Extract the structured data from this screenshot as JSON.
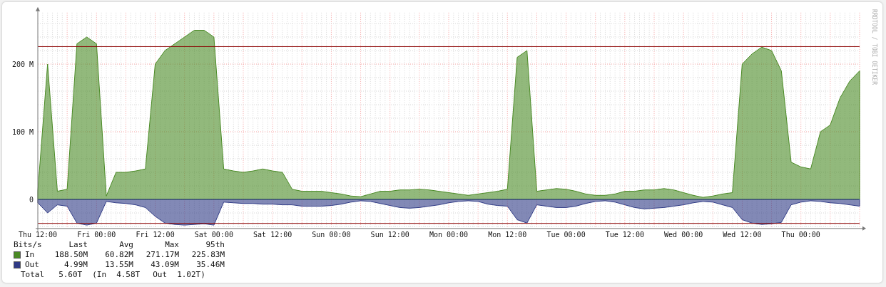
{
  "graph": {
    "credit": "RRDTOOL / TOBI OETIKER",
    "chart_data": {
      "type": "area",
      "categories": [
        "Thu 12:00",
        null,
        null,
        null,
        null,
        null,
        "Fri 00:00",
        null,
        null,
        null,
        null,
        null,
        "Fri 12:00",
        null,
        null,
        null,
        null,
        null,
        "Sat 00:00",
        null,
        null,
        null,
        null,
        null,
        "Sat 12:00",
        null,
        null,
        null,
        null,
        null,
        "Sun 00:00",
        null,
        null,
        null,
        null,
        null,
        "Sun 12:00",
        null,
        null,
        null,
        null,
        null,
        "Mon 00:00",
        null,
        null,
        null,
        null,
        null,
        "Mon 12:00",
        null,
        null,
        null,
        null,
        null,
        "Tue 00:00",
        null,
        null,
        null,
        null,
        null,
        "Tue 12:00",
        null,
        null,
        null,
        null,
        null,
        "Wed 00:00",
        null,
        null,
        null,
        null,
        null,
        "Wed 12:00",
        null,
        null,
        null,
        null,
        null,
        "Thu 00:00",
        null,
        null,
        null,
        null,
        null,
        null
      ],
      "series": [
        {
          "name": "In",
          "color": "#4a8a25",
          "values": [
            12,
            200,
            12,
            15,
            230,
            240,
            230,
            5,
            40,
            40,
            42,
            45,
            200,
            220,
            230,
            240,
            250,
            250,
            240,
            45,
            42,
            40,
            42,
            45,
            42,
            40,
            15,
            12,
            12,
            12,
            10,
            8,
            5,
            4,
            8,
            12,
            12,
            14,
            14,
            15,
            14,
            12,
            10,
            8,
            6,
            8,
            10,
            12,
            15,
            210,
            220,
            12,
            14,
            16,
            15,
            12,
            8,
            6,
            6,
            8,
            12,
            12,
            14,
            14,
            16,
            14,
            10,
            6,
            3,
            5,
            8,
            10,
            200,
            215,
            225,
            220,
            190,
            55,
            48,
            45,
            100,
            110,
            150,
            175,
            190
          ]
        },
        {
          "name": "Out",
          "color": "#2f3a85",
          "values": [
            -5,
            -20,
            -8,
            -10,
            -35,
            -38,
            -35,
            -3,
            -5,
            -6,
            -8,
            -12,
            -25,
            -35,
            -37,
            -38,
            -37,
            -36,
            -38,
            -4,
            -5,
            -6,
            -6,
            -7,
            -7,
            -8,
            -8,
            -10,
            -10,
            -10,
            -9,
            -7,
            -4,
            -2,
            -3,
            -6,
            -9,
            -12,
            -13,
            -12,
            -10,
            -8,
            -5,
            -3,
            -2,
            -3,
            -7,
            -9,
            -10,
            -30,
            -35,
            -8,
            -10,
            -12,
            -12,
            -10,
            -6,
            -3,
            -2,
            -4,
            -8,
            -12,
            -14,
            -13,
            -12,
            -10,
            -8,
            -5,
            -3,
            -4,
            -8,
            -12,
            -30,
            -35,
            -37,
            -36,
            -34,
            -8,
            -4,
            -2,
            -3,
            -5,
            -6,
            -8,
            -10
          ]
        }
      ],
      "ylim": [
        -43,
        276
      ],
      "yticks": [
        {
          "value": 0,
          "label": "0"
        },
        {
          "value": 100,
          "label": "100 M"
        },
        {
          "value": 200,
          "label": "200 M"
        }
      ],
      "grid": true,
      "ref_lines": [
        {
          "axis": "y",
          "value": 225.83,
          "color": "#8b0000"
        },
        {
          "axis": "y",
          "value": -35.46,
          "color": "#8b0000"
        }
      ]
    }
  },
  "legend": {
    "headers": [
      "Bits/s",
      "Last",
      "Avg",
      "Max",
      "95th"
    ],
    "rows": [
      {
        "values": [
          "188.50M",
          "60.82M",
          "271.17M",
          "225.83M"
        ]
      },
      {
        "values": [
          "4.99M",
          "13.55M",
          "43.09M",
          "35.46M"
        ]
      }
    ],
    "total": [
      "Total",
      "5.60T",
      "(In",
      "4.58T",
      "Out",
      "1.02T)"
    ]
  }
}
